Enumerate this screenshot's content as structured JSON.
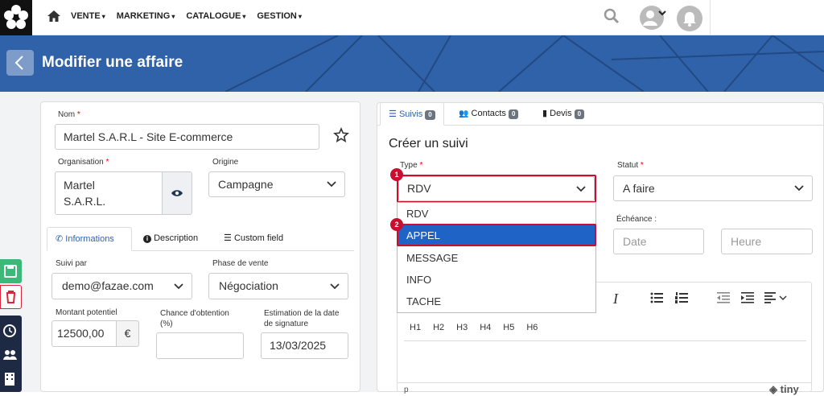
{
  "nav": {
    "menu": [
      "VENTE",
      "MARKETING",
      "CATALOGUE",
      "GESTION"
    ]
  },
  "page": {
    "title": "Modifier une affaire"
  },
  "left": {
    "nom_label": "Nom",
    "nom_value": "Martel S.A.R.L - Site E-commerce",
    "org_label": "Organisation",
    "org_value_line1": "Martel",
    "org_value_line2": "S.A.R.L.",
    "origine_label": "Origine",
    "origine_value": "Campagne",
    "tabs": [
      "Informations",
      "Description",
      "Custom field"
    ],
    "suivi_label": "Suivi par",
    "suivi_value": "demo@fazae.com",
    "phase_label": "Phase de vente",
    "phase_value": "Négociation",
    "montant_label": "Montant potentiel",
    "montant_value": "12500,00",
    "currency": "€",
    "chance_label_1": "Chance d'obtention",
    "chance_label_2": "(%)",
    "chance_value": "",
    "estimation_label_1": "Estimation de la date",
    "estimation_label_2": "de signature",
    "estimation_value": "13/03/2025"
  },
  "right": {
    "tabs": [
      {
        "label": "Suivis",
        "count": "0"
      },
      {
        "label": "Contacts",
        "count": "0"
      },
      {
        "label": "Devis",
        "count": "0"
      }
    ],
    "heading": "Créer un suivi",
    "type_label": "Type",
    "type_value": "RDV",
    "statut_label": "Statut",
    "statut_value": "A faire",
    "echeance_label": "Échéance :",
    "date_placeholder": "Date",
    "heure_placeholder": "Heure",
    "type_options": [
      "RDV",
      "APPEL",
      "MESSAGE",
      "INFO",
      "TACHE"
    ],
    "selected_option": "APPEL",
    "markers": [
      "1",
      "2"
    ],
    "headings": [
      "H1",
      "H2",
      "H3",
      "H4",
      "H5",
      "H6"
    ],
    "italic": "I",
    "editor_footer": "p",
    "tiny": "tiny"
  },
  "colors": {
    "primary": "#2f62a8",
    "highlight": "#1f63c6",
    "annotation": "#c8102e",
    "save": "#3cb878",
    "delete": "#d9263a",
    "dark": "#1e2a44"
  }
}
